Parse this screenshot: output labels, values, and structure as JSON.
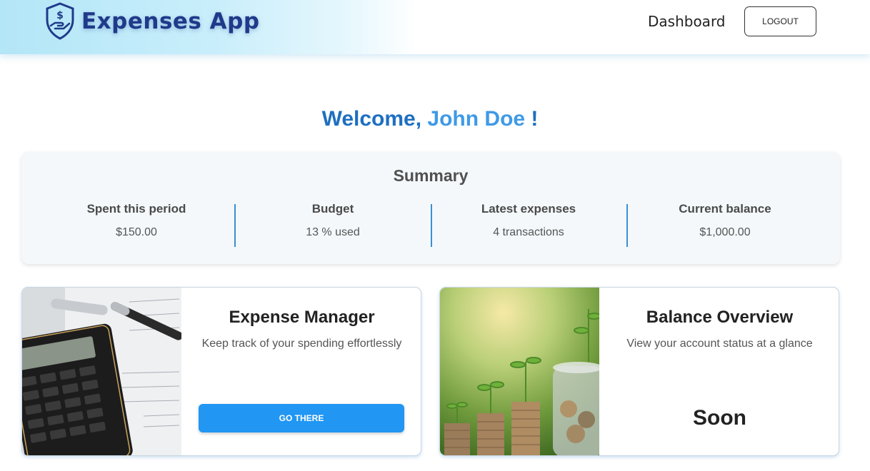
{
  "header": {
    "app_title": "Expenses App",
    "nav_dashboard": "Dashboard",
    "logout_label": "LOGOUT"
  },
  "welcome": {
    "prefix": "Welcome, ",
    "name": "John Doe",
    "suffix": " !"
  },
  "summary": {
    "title": "Summary",
    "stats": [
      {
        "label": "Spent this period",
        "value": "$150.00"
      },
      {
        "label": "Budget",
        "value": "13 % used"
      },
      {
        "label": "Latest expenses",
        "value": "4 transactions"
      },
      {
        "label": "Current balance",
        "value": "$1,000.00"
      }
    ]
  },
  "cards": [
    {
      "title": "Expense Manager",
      "description": "Keep track of your spending effortlessly",
      "button_label": "GO THERE"
    },
    {
      "title": "Balance Overview",
      "description": "View your account status at a glance",
      "status": "Soon"
    }
  ],
  "colors": {
    "brand_navy": "#1f3a8a",
    "accent_blue": "#2196f3",
    "welcome_blue": "#1e6fc0",
    "name_blue": "#3f9ae6",
    "divider_blue": "#3a8fd1"
  },
  "icons": {
    "logo": "shield-hand-dollar-icon"
  }
}
